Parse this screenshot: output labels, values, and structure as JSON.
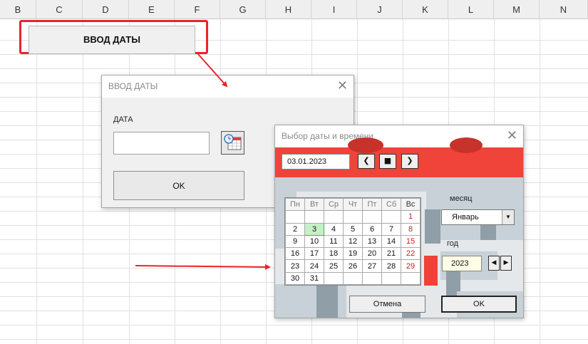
{
  "sheet": {
    "columns": [
      "B",
      "C",
      "D",
      "E",
      "F",
      "G",
      "H",
      "I",
      "J",
      "K",
      "L",
      "M",
      "N"
    ],
    "button_label": "ВВОД ДАТЫ"
  },
  "dialog_input": {
    "title": "ВВОД ДАТЫ",
    "close_glyph": "✕",
    "date_label": "ДАТА",
    "date_value": "",
    "calendar_icon": "calendar-clock-icon",
    "ok_label": "OK"
  },
  "dialog_picker": {
    "title": "Выбор даты и времени",
    "close_glyph": "✕",
    "selected_date": "03.01.2023",
    "nav": {
      "prev": "❮",
      "today": "■",
      "next": "❯"
    },
    "weekdays": [
      "Пн",
      "Вт",
      "Ср",
      "Чт",
      "Пт",
      "Сб",
      "Вс"
    ],
    "weeks": [
      [
        "",
        "",
        "",
        "",
        "",
        "",
        "1"
      ],
      [
        "2",
        "3",
        "4",
        "5",
        "6",
        "7",
        "8"
      ],
      [
        "9",
        "10",
        "11",
        "12",
        "13",
        "14",
        "15"
      ],
      [
        "16",
        "17",
        "18",
        "19",
        "20",
        "21",
        "22"
      ],
      [
        "23",
        "24",
        "25",
        "26",
        "27",
        "28",
        "29"
      ],
      [
        "30",
        "31",
        "",
        "",
        "",
        "",
        ""
      ]
    ],
    "selected_day": "3",
    "month_label": "месяц",
    "month_value": "Январь",
    "year_label": "год",
    "year_value": "2023",
    "year_prev": "◀",
    "year_next": "▶",
    "cancel_label": "Отмена",
    "ok_label": "OK"
  },
  "colors": {
    "annotation_red": "#e8242b",
    "picker_band": "#f0433a",
    "sunday_text": "#d11b1b",
    "selected_day_bg": "#c7efc7"
  }
}
